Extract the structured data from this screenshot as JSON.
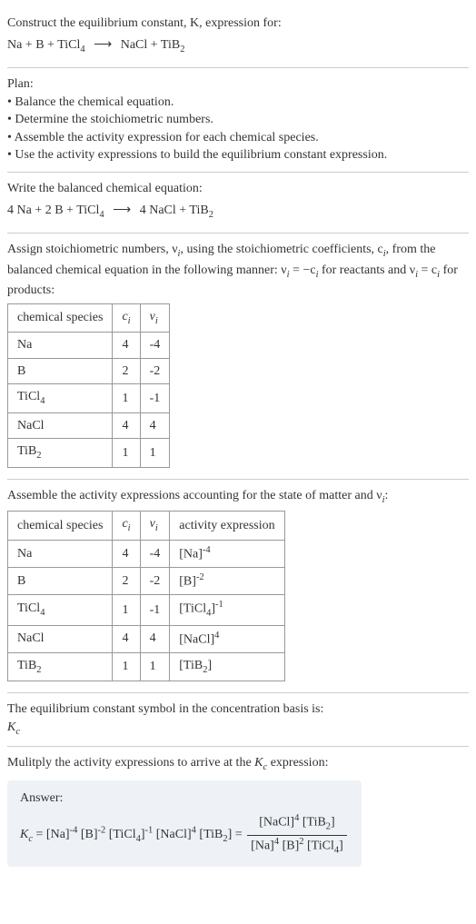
{
  "prompt": {
    "line1": "Construct the equilibrium constant, K, expression for:",
    "eq_lhs": "Na + B + TiCl",
    "eq_sub1": "4",
    "eq_arrow": "⟶",
    "eq_rhs1": "NaCl + TiB",
    "eq_sub2": "2"
  },
  "plan": {
    "head": "Plan:",
    "b1": "• Balance the chemical equation.",
    "b2": "• Determine the stoichiometric numbers.",
    "b3": "• Assemble the activity expression for each chemical species.",
    "b4": "• Use the activity expressions to build the equilibrium constant expression."
  },
  "balanced": {
    "head": "Write the balanced chemical equation:",
    "lhs": "4 Na + 2 B + TiCl",
    "sub1": "4",
    "arrow": "⟶",
    "rhs": "4 NaCl + TiB",
    "sub2": "2"
  },
  "assign": {
    "text1": "Assign stoichiometric numbers, ν",
    "text1_sub": "i",
    "text2": ", using the stoichiometric coefficients, c",
    "text2_sub": "i",
    "text3": ", from the balanced chemical equation in the following manner: ν",
    "text3_sub": "i",
    "text4": " = −c",
    "text4_sub": "i",
    "text5": " for reactants and ν",
    "text5_sub": "i",
    "text6": " = c",
    "text6_sub": "i",
    "text7": " for products:"
  },
  "t1": {
    "h1": "chemical species",
    "h2_c": "c",
    "h2_sub": "i",
    "h3_n": "ν",
    "h3_sub": "i",
    "r1": {
      "sp": "Na",
      "c": "4",
      "n": "-4"
    },
    "r2": {
      "sp": "B",
      "c": "2",
      "n": "-2"
    },
    "r3": {
      "sp_a": "TiCl",
      "sp_sub": "4",
      "c": "1",
      "n": "-1"
    },
    "r4": {
      "sp": "NaCl",
      "c": "4",
      "n": "4"
    },
    "r5": {
      "sp_a": "TiB",
      "sp_sub": "2",
      "c": "1",
      "n": "1"
    }
  },
  "assemble": {
    "text1": "Assemble the activity expressions accounting for the state of matter and ν",
    "text1_sub": "i",
    "text2": ":"
  },
  "t2": {
    "h1": "chemical species",
    "h2_c": "c",
    "h2_sub": "i",
    "h3_n": "ν",
    "h3_sub": "i",
    "h4": "activity expression",
    "r1": {
      "sp": "Na",
      "c": "4",
      "n": "-4",
      "act_b": "[Na]",
      "act_sup": "-4"
    },
    "r2": {
      "sp": "B",
      "c": "2",
      "n": "-2",
      "act_b": "[B]",
      "act_sup": "-2"
    },
    "r3": {
      "sp_a": "TiCl",
      "sp_sub": "4",
      "c": "1",
      "n": "-1",
      "act_a": "[TiCl",
      "act_sub": "4",
      "act_c": "]",
      "act_sup": "-1"
    },
    "r4": {
      "sp": "NaCl",
      "c": "4",
      "n": "4",
      "act_b": "[NaCl]",
      "act_sup": "4"
    },
    "r5": {
      "sp_a": "TiB",
      "sp_sub": "2",
      "c": "1",
      "n": "1",
      "act_a": "[TiB",
      "act_sub": "2",
      "act_c": "]"
    }
  },
  "symbol": {
    "text": "The equilibrium constant symbol in the concentration basis is:",
    "k": "K",
    "ksub": "c"
  },
  "multiply": {
    "text1": "Mulitply the activity expressions to arrive at the ",
    "k": "K",
    "ksub": "c",
    "text2": " expression:"
  },
  "answer": {
    "label": "Answer:",
    "k": "K",
    "ksub": "c",
    "eq": " = ",
    "p1": "[Na]",
    "p1_sup": "-4",
    "p2": " [B]",
    "p2_sup": "-2",
    "p3a": " [TiCl",
    "p3_sub": "4",
    "p3b": "]",
    "p3_sup": "-1",
    "p4": " [NaCl]",
    "p4_sup": "4",
    "p5a": " [TiB",
    "p5_sub": "2",
    "p5b": "] = ",
    "num1": "[NaCl]",
    "num1_sup": "4",
    "num2a": " [TiB",
    "num2_sub": "2",
    "num2b": "]",
    "den1": "[Na]",
    "den1_sup": "4",
    "den2": " [B]",
    "den2_sup": "2",
    "den3a": " [TiCl",
    "den3_sub": "4",
    "den3b": "]"
  }
}
